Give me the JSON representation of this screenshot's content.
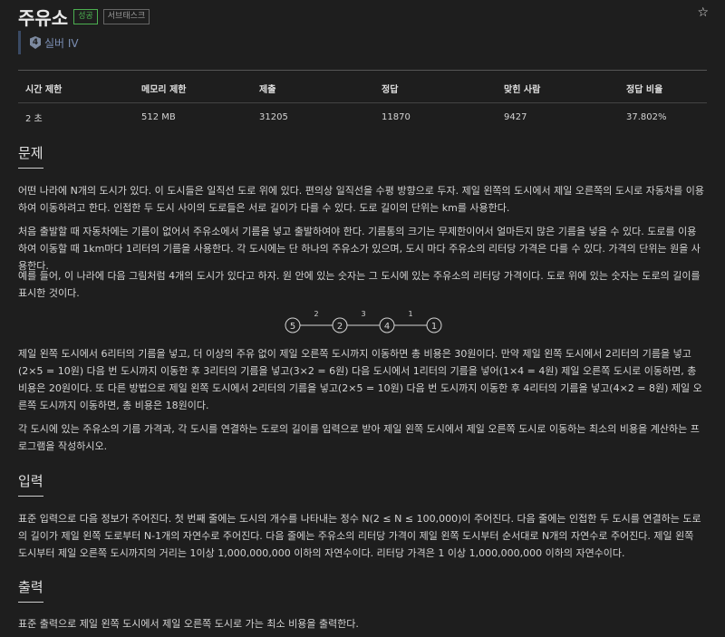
{
  "header": {
    "title": "주유소",
    "badge_success": "성공",
    "badge_subtask": "서브태스크",
    "star_icon": "☆",
    "tier_icon_digit": "4",
    "tier_label": "실버 IV"
  },
  "stats": {
    "headers": [
      "시간 제한",
      "메모리 제한",
      "제출",
      "정답",
      "맞힌 사람",
      "정답 비율"
    ],
    "values": [
      "2 초",
      "512 MB",
      "31205",
      "11870",
      "9427",
      "37.802%"
    ]
  },
  "problem": {
    "heading": "문제",
    "p1": "어떤 나라에 N개의 도시가 있다. 이 도시들은 일직선 도로 위에 있다. 편의상 일직선을 수평 방향으로 두자. 제일 왼쪽의 도시에서 제일 오른쪽의 도시로 자동차를 이용하여 이동하려고 한다. 인접한 두 도시 사이의 도로들은 서로 길이가 다를 수 있다. 도로 길이의 단위는 km를 사용한다.",
    "p2": "처음 출발할 때 자동차에는 기름이 없어서 주유소에서 기름을 넣고 출발하여야 한다. 기름통의 크기는 무제한이어서 얼마든지 많은 기름을 넣을 수 있다. 도로를 이용하여 이동할 때 1km마다 1리터의 기름을 사용한다. 각 도시에는 단 하나의 주유소가 있으며, 도시 마다 주유소의 리터당 가격은 다를 수 있다. 가격의 단위는 원을 사용한다.",
    "p3": "예를 들어, 이 나라에 다음 그림처럼 4개의 도시가 있다고 하자. 원 안에 있는 숫자는 그 도시에 있는 주유소의 리터당 가격이다. 도로 위에 있는 숫자는 도로의 길이를 표시한 것이다.",
    "diagram": {
      "cities": [
        "5",
        "2",
        "4",
        "1"
      ],
      "roads": [
        "2",
        "3",
        "1"
      ]
    },
    "p4": "제일 왼쪽 도시에서 6리터의 기름을 넣고, 더 이상의 주유 없이 제일 오른쪽 도시까지 이동하면 총 비용은 30원이다. 만약 제일 왼쪽 도시에서 2리터의 기름을 넣고(2×5 = 10원) 다음 번 도시까지 이동한 후 3리터의 기름을 넣고(3×2 = 6원) 다음 도시에서 1리터의 기름을 넣어(1×4 = 4원) 제일 오른쪽 도시로 이동하면, 총 비용은 20원이다. 또 다른 방법으로 제일 왼쪽 도시에서 2리터의 기름을 넣고(2×5 = 10원) 다음 번 도시까지 이동한 후 4리터의 기름을 넣고(4×2 = 8원) 제일 오른쪽 도시까지 이동하면, 총 비용은 18원이다.",
    "p5": "각 도시에 있는 주유소의 기름 가격과, 각 도시를 연결하는 도로의 길이를 입력으로 받아 제일 왼쪽 도시에서 제일 오른쪽 도시로 이동하는 최소의 비용을 계산하는 프로그램을 작성하시오."
  },
  "input": {
    "heading": "입력",
    "p1": "표준 입력으로 다음 정보가 주어진다. 첫 번째 줄에는 도시의 개수를 나타내는 정수 N(2 ≤ N ≤ 100,000)이 주어진다. 다음 줄에는 인접한 두 도시를 연결하는 도로의 길이가 제일 왼쪽 도로부터 N-1개의 자연수로 주어진다. 다음 줄에는 주유소의 리터당 가격이 제일 왼쪽 도시부터 순서대로 N개의 자연수로 주어진다. 제일 왼쪽 도시부터 제일 오른쪽 도시까지의 거리는 1이상 1,000,000,000 이하의 자연수이다. 리터당 가격은 1 이상 1,000,000,000 이하의 자연수이다."
  },
  "output": {
    "heading": "출력",
    "p1": "표준 출력으로 제일 왼쪽 도시에서 제일 오른쪽 도시로 가는 최소 비용을 출력한다."
  }
}
